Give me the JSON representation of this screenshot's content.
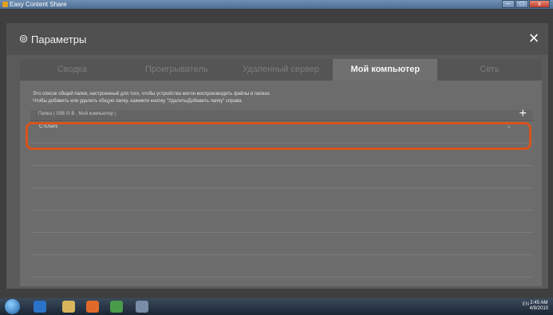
{
  "window": {
    "title": "Easy Content Share"
  },
  "dialog": {
    "title": "Параметры",
    "tabs": [
      {
        "label": "Сводка",
        "active": false
      },
      {
        "label": "Проигрыватель",
        "active": false
      },
      {
        "label": "Удаленный сервер",
        "active": false
      },
      {
        "label": "Мой компьютер",
        "active": true
      },
      {
        "label": "Сеть",
        "active": false
      }
    ],
    "description_line1": "Это список общей папки, настроенный для того, чтобы устройства могли воспроизводить файлы в папках.",
    "description_line2": "Чтобы добавить или удалить общую папку, нажмите кнопку \"Удалить/Добавить папку\" справа.",
    "list_header": "Папка ( 00B /0 B , Мой компьютер )",
    "add_symbol": "+",
    "rows": [
      {
        "path": "C:\\Users",
        "remove_symbol": "×"
      }
    ]
  },
  "taskbar": {
    "tray": "EN",
    "time": "2:45 AM",
    "date": "4/9/2010"
  },
  "colors": {
    "highlight": "#d8531c",
    "dialog_bg": "#5a5a5a",
    "active_tab": "#707070"
  }
}
